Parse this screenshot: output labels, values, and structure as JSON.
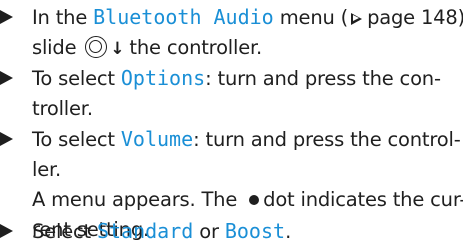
{
  "steps": [
    {
      "lines": [
        [
          "In the ",
          "Bluetooth Audio",
          " menu (",
          "page 148),"
        ],
        [
          "slide ",
          "the controller."
        ]
      ]
    },
    {
      "lines": [
        [
          "To select ",
          "Options",
          ": turn and press the con-"
        ],
        [
          "troller."
        ]
      ]
    },
    {
      "lines": [
        [
          "To select ",
          "Volume",
          ": turn and press the control-"
        ],
        [
          "ler."
        ],
        [
          "A menu appears. The ",
          "dot indicates the cur-"
        ],
        [
          "rent setting."
        ]
      ]
    },
    {
      "lines": [
        [
          "Select ",
          "Standard",
          " or ",
          "Boost",
          "."
        ]
      ]
    }
  ],
  "icons": {
    "bullet": "triangle-bullet-icon",
    "page_ref": "page-reference-triangle-icon",
    "controller": "controller-knob-icon",
    "slide_down": "slide-down-arrow-icon",
    "dot": "filled-dot-icon"
  },
  "colors": {
    "text": "#1f1f1f",
    "menu_item": "#1a8fd6",
    "background": "#ffffff"
  }
}
